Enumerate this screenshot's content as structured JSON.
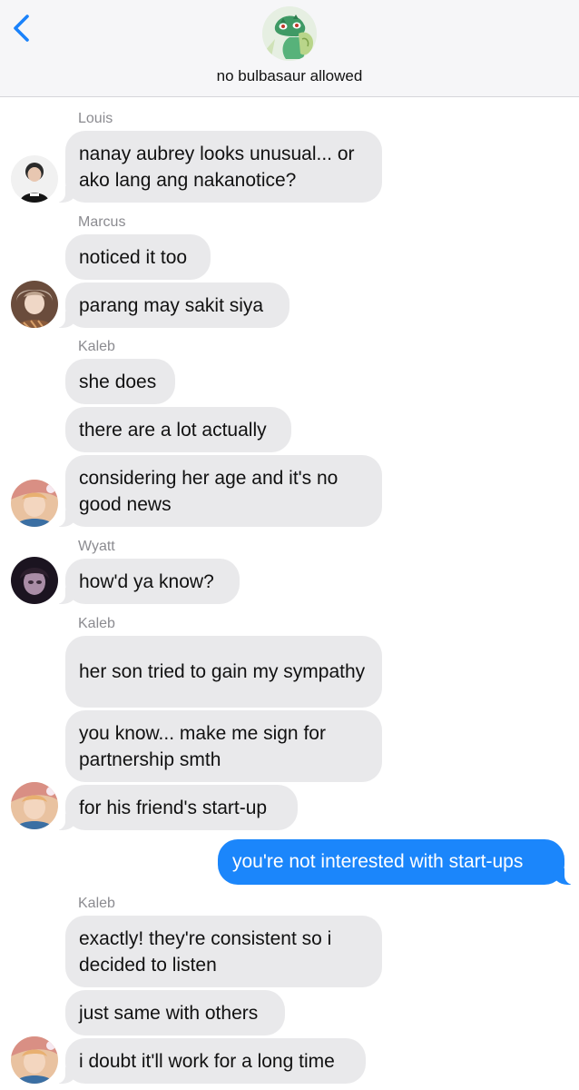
{
  "header": {
    "group_name": "no bulbasaur allowed",
    "back_icon": "chevron-left-icon",
    "group_avatar_icon": "bulbasaur-avatar-icon",
    "accent_color": "#1a82fb"
  },
  "messages": {
    "louis": {
      "sender": "Louis",
      "m1": "nanay aubrey looks unusual... or ako lang ang nakanotice?"
    },
    "marcus": {
      "sender": "Marcus",
      "m1": "noticed it too",
      "m2": "parang may sakit siya"
    },
    "kaleb1": {
      "sender": "Kaleb",
      "m1": "she does",
      "m2": "there are a lot actually",
      "m3": "considering her age and it's no good news"
    },
    "wyatt": {
      "sender": "Wyatt",
      "m1": "how'd ya know?"
    },
    "kaleb2": {
      "sender": "Kaleb",
      "m1": "her son tried to gain my sympathy",
      "m2": "you know... make me sign for partnership smth",
      "m3": "for his friend's start-up"
    },
    "me": {
      "m1": "you're not interested with start-ups"
    },
    "kaleb3": {
      "sender": "Kaleb",
      "m1": "exactly! they're consistent so i decided to listen",
      "m2": "just same with others",
      "m3": "i doubt it'll work for a long time"
    }
  },
  "colors": {
    "received_bubble": "#e9e9eb",
    "sent_bubble": "#1b86fb",
    "sender_name": "#8b8b90"
  }
}
